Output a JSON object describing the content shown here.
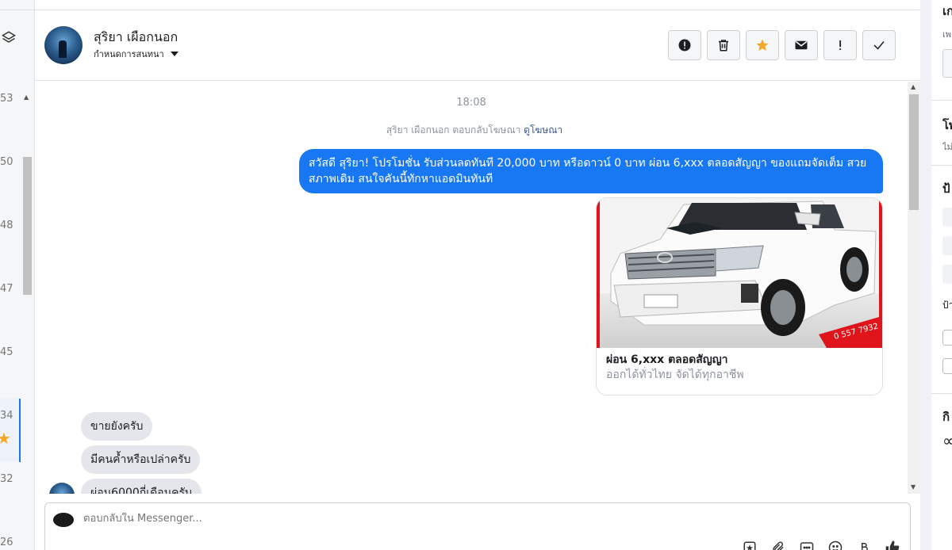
{
  "contact": {
    "name": "สุริยา เผือกนอก",
    "assign_label": "กำหนดการสนทนา"
  },
  "list_strip": {
    "numbers": [
      "53",
      "50",
      "48",
      "47",
      "45",
      "34",
      "32",
      "26"
    ]
  },
  "messages": {
    "time": "18:08",
    "reply_prefix": "สุริยา เผือกนอก ตอบกลับโฆษณา",
    "reply_link": "ดูโฆษณา",
    "outgoing": "สวัสดี สุริยา! โปรโมชั่น รับส่วนลดทันที 20,000 บาท หรือดาวน์ 0 บาท ผ่อน 6,xxx ตลอดสัญญา ของแถมจัดเต็ม สวยสภาพเดิม สนใจคันนี้ทักหาแอดมินทันที",
    "ad_title": "ผ่อน 6,xxx ตลอดสัญญา",
    "ad_subtitle": "ออกได้ทั่วไทย จัดได้ทุกอาชีพ",
    "ad_phone": "0 557 7932",
    "incoming": [
      "ขายยังครับ",
      "มีคนค้ำหรือเปล่าครับ",
      "ผ่อน6000กี่เดือนครับ"
    ]
  },
  "composer": {
    "placeholder": "ตอบกลับใน Messenger..."
  },
  "right_panel": {
    "fragments": [
      "เก",
      "เพ",
      "โพ",
      "ไม่",
      "ป้",
      "ป้า",
      "กิ",
      "∞"
    ]
  },
  "colors": {
    "brand_blue": "#1877f2",
    "star": "#f5a623",
    "ad_border_red": "#e0151b"
  }
}
